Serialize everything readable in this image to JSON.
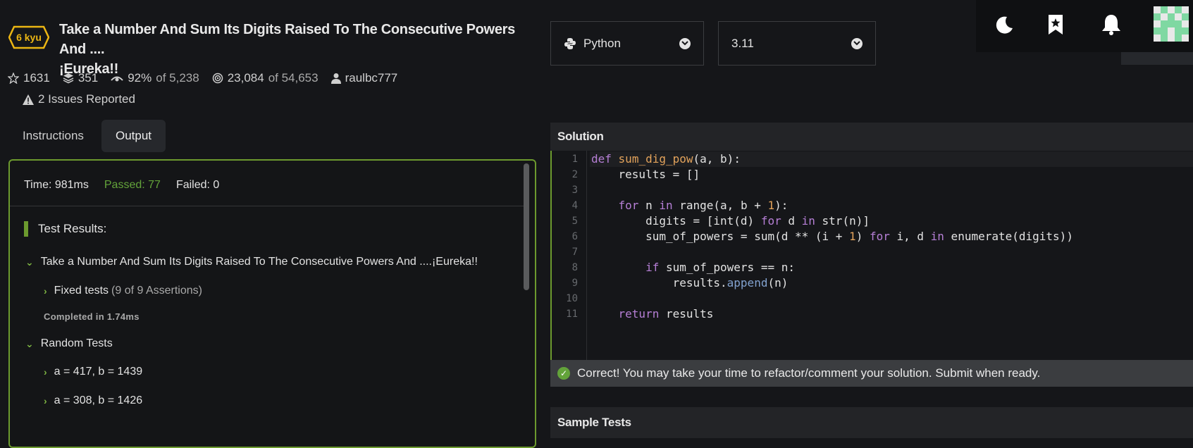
{
  "kata": {
    "rank": "6 kyu",
    "title": "Take a Number And Sum Its Digits Raised To The Consecutive Powers And ....¡Eureka!!",
    "title_line1": "Take a Number And Sum Its Digits Raised To The Consecutive Powers And ....",
    "title_line2": "¡Eureka!!",
    "stars": "1631",
    "collections": "351",
    "satisfaction": "92%",
    "satisfaction_of": "of 5,238",
    "completed": "23,084",
    "completed_of": "of 54,653",
    "author": "raulbc777",
    "issues": "2 Issues Reported"
  },
  "tabs": {
    "instructions": "Instructions",
    "output": "Output"
  },
  "output": {
    "time": "Time: 981ms",
    "passed": "Passed: 77",
    "failed": "Failed: 0",
    "results_heading": "Test Results:",
    "suite": "Take a Number And Sum Its Digits Raised To The Consecutive Powers And ....¡Eureka!!",
    "fixed_label": "Fixed tests",
    "fixed_assertions": "(9 of 9 Assertions)",
    "fixed_completed": "Completed in 1.74ms",
    "random_label": "Random Tests",
    "random_items": [
      "a = 417, b = 1439",
      "a = 308, b = 1426"
    ]
  },
  "language": {
    "name": "Python",
    "version": "3.11"
  },
  "solution": {
    "heading": "Solution",
    "line_numbers": [
      "1",
      "2",
      "3",
      "4",
      "5",
      "6",
      "7",
      "8",
      "9",
      "10",
      "11"
    ],
    "status": "Correct! You may take your time to refactor/comment your solution. Submit when ready."
  },
  "sample": {
    "heading": "Sample Tests"
  },
  "toolbar": {
    "icons": [
      "moon-icon",
      "bookmark-icon",
      "bell-icon",
      "avatar"
    ]
  },
  "colors": {
    "accent_green": "#6c9a2e",
    "passed_green": "#63a33a",
    "kyu_yellow": "#ecb613",
    "background": "#151619"
  }
}
